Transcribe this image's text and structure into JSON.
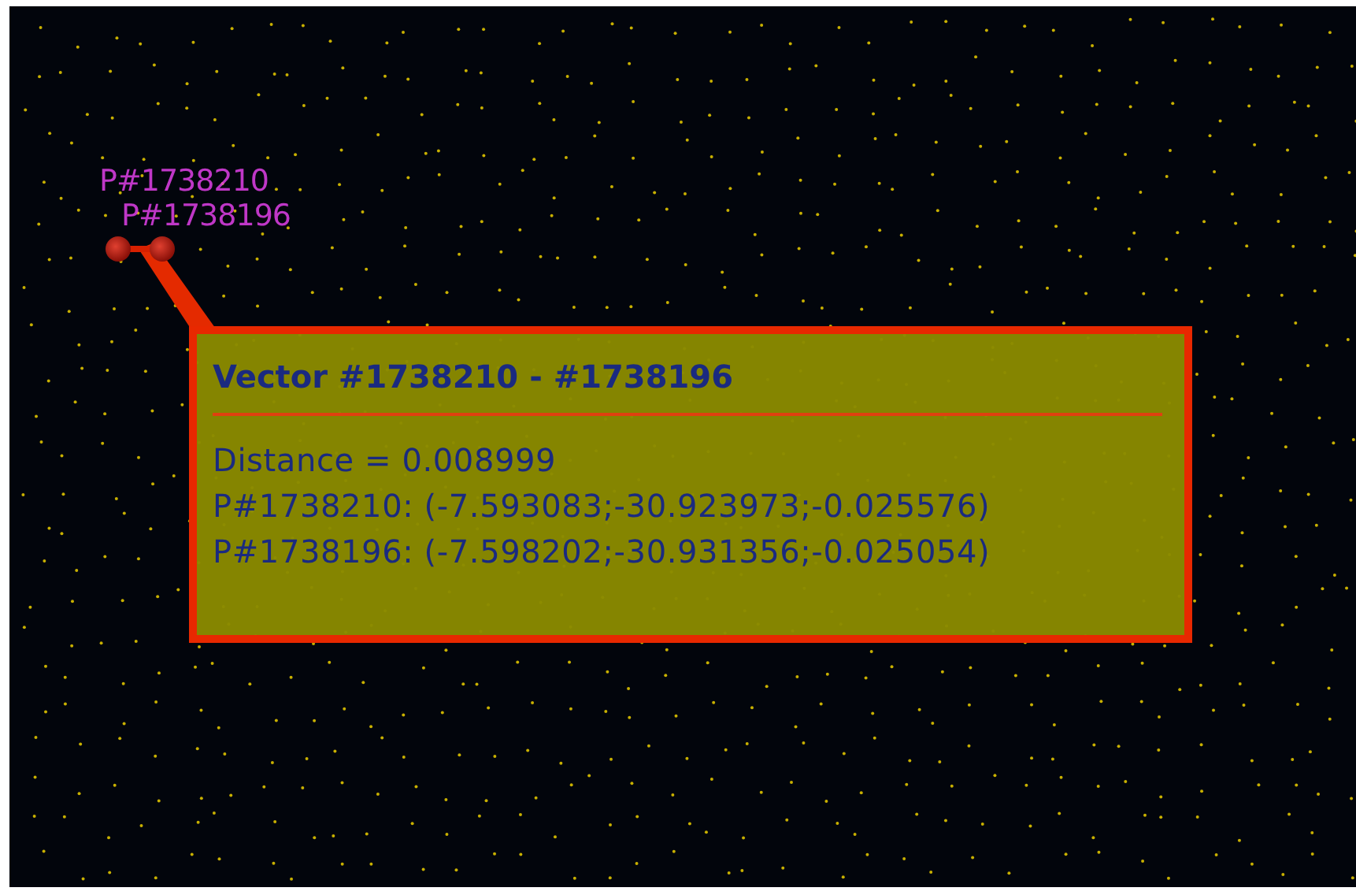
{
  "viewport": {
    "point_labels": [
      {
        "text": "P#1738210"
      },
      {
        "text": "P#1738196"
      }
    ],
    "tooltip": {
      "title": "Vector #1738210 - #1738196",
      "lines": [
        "Distance = 0.008999",
        "P#1738210: (-7.593083;-30.923973;-0.025576)",
        "P#1738196: (-7.598202;-30.931356;-0.025054)"
      ]
    }
  }
}
